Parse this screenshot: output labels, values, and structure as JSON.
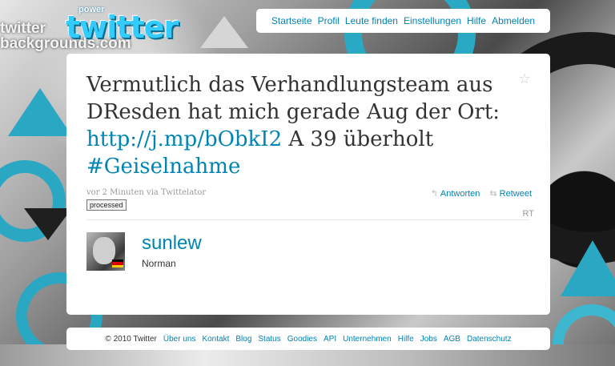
{
  "logo": {
    "power": "power",
    "word": "twitter",
    "bg_tag": "twitter\nbackgrounds.com"
  },
  "nav": [
    "Startseite",
    "Profil",
    "Leute finden",
    "Einstellungen",
    "Hilfe",
    "Abmelden"
  ],
  "tweet": {
    "text_1": "Vermutlich das Verhandlungsteam aus DResden hat mich gerade Aug der Ort: ",
    "link": "http://j.mp/bObkI2",
    "text_2": " A 39 überholt ",
    "hashtag": "#Geiselnahme",
    "meta": "vor 2 Minuten via Twittelator",
    "processed": "processed",
    "reply": "Antworten",
    "retweet": "Retweet",
    "rt": "RT"
  },
  "user": {
    "username": "sunlew",
    "realname": "Norman"
  },
  "footer": {
    "copyright": "© 2010 Twitter",
    "links": [
      "Über uns",
      "Kontakt",
      "Blog",
      "Status",
      "Goodies",
      "API",
      "Unternehmen",
      "Hilfe",
      "Jobs",
      "AGB",
      "Datenschutz"
    ]
  },
  "colors": {
    "link": "#0084b4",
    "accent": "#33ccff"
  },
  "icons": {
    "favorite": "star-icon",
    "reply": "reply-icon",
    "retweet": "retweet-icon"
  }
}
